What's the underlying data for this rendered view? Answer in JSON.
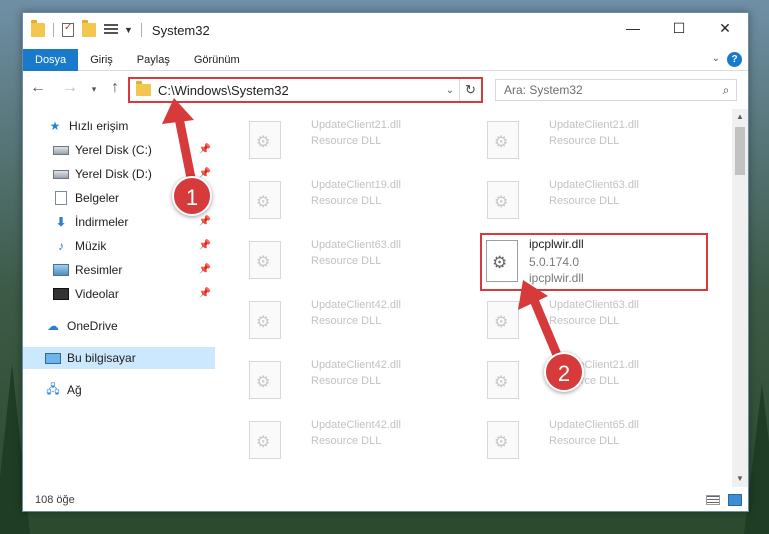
{
  "window": {
    "title": "System32",
    "controls": {
      "minimize": "—",
      "maximize": "☐",
      "close": "✕"
    }
  },
  "ribbon": {
    "tabs": [
      "Dosya",
      "Giriş",
      "Paylaş",
      "Görünüm"
    ],
    "help": "?"
  },
  "navigation": {
    "address": "C:\\Windows\\System32",
    "search_placeholder": "Ara: System32"
  },
  "sidebar": {
    "items": [
      {
        "label": "Hızlı erişim",
        "icon": "star-icon",
        "pinned": false
      },
      {
        "label": "Yerel Disk (C:)",
        "icon": "disk-icon",
        "pinned": true
      },
      {
        "label": "Yerel Disk (D:)",
        "icon": "disk-icon",
        "pinned": true
      },
      {
        "label": "Belgeler",
        "icon": "documents-icon",
        "pinned": true
      },
      {
        "label": "İndirmeler",
        "icon": "download-icon",
        "pinned": true
      },
      {
        "label": "Müzik",
        "icon": "music-icon",
        "pinned": true
      },
      {
        "label": "Resimler",
        "icon": "pictures-icon",
        "pinned": true
      },
      {
        "label": "Videolar",
        "icon": "videos-icon",
        "pinned": true
      },
      {
        "label": "OneDrive",
        "icon": "cloud-icon",
        "pinned": false
      },
      {
        "label": "Bu bilgisayar",
        "icon": "computer-icon",
        "pinned": false,
        "selected": true
      },
      {
        "label": "Ağ",
        "icon": "network-icon",
        "pinned": false
      }
    ]
  },
  "files": [
    {
      "name": "UpdateClient21.dll",
      "type": "Resource DLL"
    },
    {
      "name": "UpdateClient21.dll",
      "type": "Resource DLL"
    },
    {
      "name": "UpdateClient19.dll",
      "type": "Resource DLL"
    },
    {
      "name": "UpdateClient63.dll",
      "type": "Resource DLL"
    },
    {
      "name": "UpdateClient63.dll",
      "type": "Resource DLL"
    },
    {
      "name": "UpdateClient42.dll",
      "type": "Resource DLL"
    },
    {
      "name": "UpdateClient63.dll",
      "type": "Resource DLL"
    },
    {
      "name": "UpdateClient42.dll",
      "type": "Resource DLL"
    },
    {
      "name": "UpdateClient21.dll",
      "type": "Resource DLL"
    },
    {
      "name": "UpdateClient42.dll",
      "type": "Resource DLL"
    },
    {
      "name": "UpdateClient65.dll",
      "type": "Resource DLL"
    }
  ],
  "selected_file": {
    "name": "ipcplwir.dll",
    "version": "5.0.174.0",
    "description": "ipcplwir.dll"
  },
  "status": {
    "count": "108 öğe"
  },
  "annotations": {
    "step1": "1",
    "step2": "2",
    "color": "#d63a3a"
  }
}
